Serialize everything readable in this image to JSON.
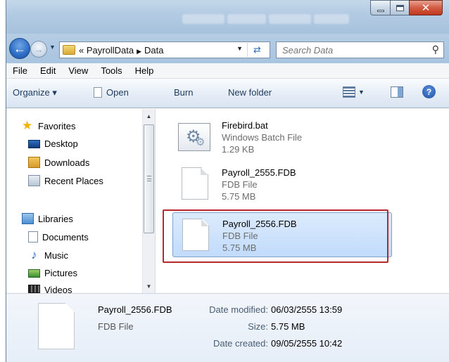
{
  "window": {
    "caption_close": "✕"
  },
  "nav": {
    "back_icon": "arrow-left-icon",
    "forward_icon": "arrow-right-icon",
    "breadcrumb_prefix": "«",
    "breadcrumb": [
      "PayrollData",
      "Data"
    ],
    "search_placeholder": "Search Data"
  },
  "menu": [
    "File",
    "Edit",
    "View",
    "Tools",
    "Help"
  ],
  "toolbar": {
    "organize": "Organize ▾",
    "open": "Open",
    "burn": "Burn",
    "new_folder": "New folder",
    "help": "?"
  },
  "sidebar": {
    "favorites": "Favorites",
    "favorites_items": [
      "Desktop",
      "Downloads",
      "Recent Places"
    ],
    "libraries": "Libraries",
    "libraries_items": [
      "Documents",
      "Music",
      "Pictures",
      "Videos"
    ]
  },
  "files": [
    {
      "name": "Firebird.bat",
      "type": "Windows Batch File",
      "size": "1.29 KB",
      "icon": "batch-file-icon",
      "selected": false
    },
    {
      "name": "Payroll_2555.FDB",
      "type": "FDB File",
      "size": "5.75 MB",
      "icon": "document-icon",
      "selected": false
    },
    {
      "name": "Payroll_2556.FDB",
      "type": "FDB File",
      "size": "5.75 MB",
      "icon": "document-icon",
      "selected": true
    }
  ],
  "details": {
    "name": "Payroll_2556.FDB",
    "type": "FDB File",
    "date_modified_label": "Date modified:",
    "date_modified": "06/03/2555 13:59",
    "size_label": "Size:",
    "size": "5.75 MB",
    "date_created_label": "Date created:",
    "date_created": "09/05/2555 10:42"
  },
  "colors": {
    "highlight_border": "#b5292c",
    "selection": "#c1dbfc"
  }
}
